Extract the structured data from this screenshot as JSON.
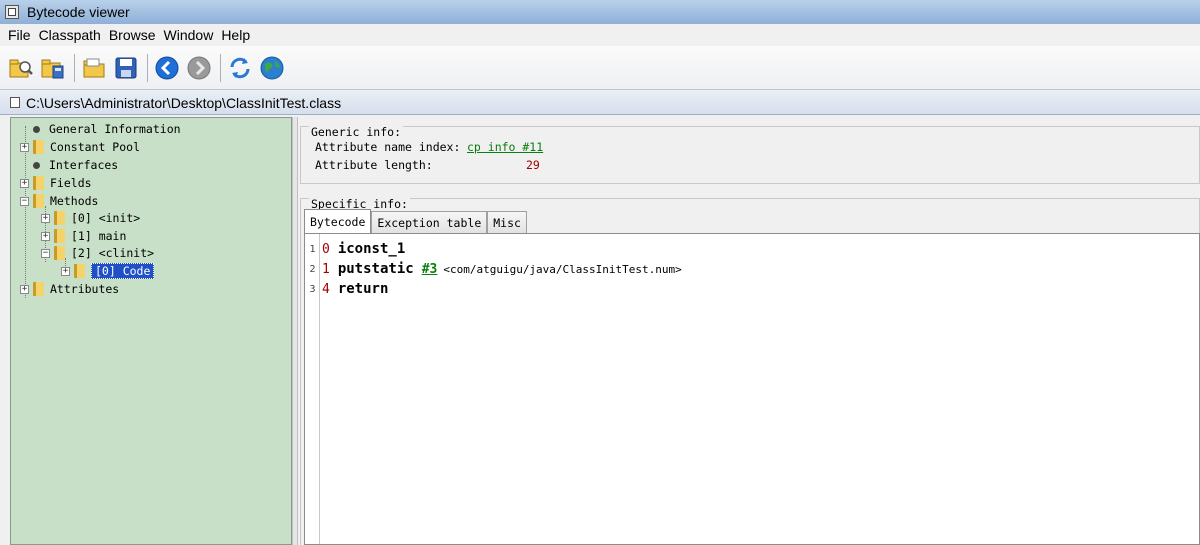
{
  "window": {
    "title": "Bytecode viewer"
  },
  "menu": [
    "File",
    "Classpath",
    "Browse",
    "Window",
    "Help"
  ],
  "toolbar": {
    "icons": [
      "open-class-icon",
      "open-classpath-icon",
      "open-folder-icon",
      "save-icon",
      "back-icon",
      "forward-icon",
      "reload-icon",
      "web-icon"
    ]
  },
  "path": "C:\\Users\\Administrator\\Desktop\\ClassInitTest.class",
  "tree": {
    "general_information": "General Information",
    "constant_pool": "Constant Pool",
    "interfaces": "Interfaces",
    "fields": "Fields",
    "methods": "Methods",
    "method_init": "[0] <init>",
    "method_main": "[1] main",
    "method_clinit": "[2] <clinit>",
    "clinit_code": "[0] Code",
    "attributes": "Attributes"
  },
  "generic_info": {
    "title": "Generic info:",
    "attr_name_index_label": "Attribute name index:",
    "attr_name_index_value": "cp info #11",
    "attr_length_label": "Attribute length:",
    "attr_length_value": "29"
  },
  "specific_info": {
    "title": "Specific info:",
    "tabs": [
      "Bytecode",
      "Exception table",
      "Misc"
    ]
  },
  "bytecode": {
    "lines": [
      {
        "line": "1",
        "offset": "0",
        "op": "iconst_1",
        "ref": "",
        "comment": ""
      },
      {
        "line": "2",
        "offset": "1",
        "op": "putstatic",
        "ref": "#3",
        "comment": "<com/atguigu/java/ClassInitTest.num>"
      },
      {
        "line": "3",
        "offset": "4",
        "op": "return",
        "ref": "",
        "comment": ""
      }
    ]
  }
}
